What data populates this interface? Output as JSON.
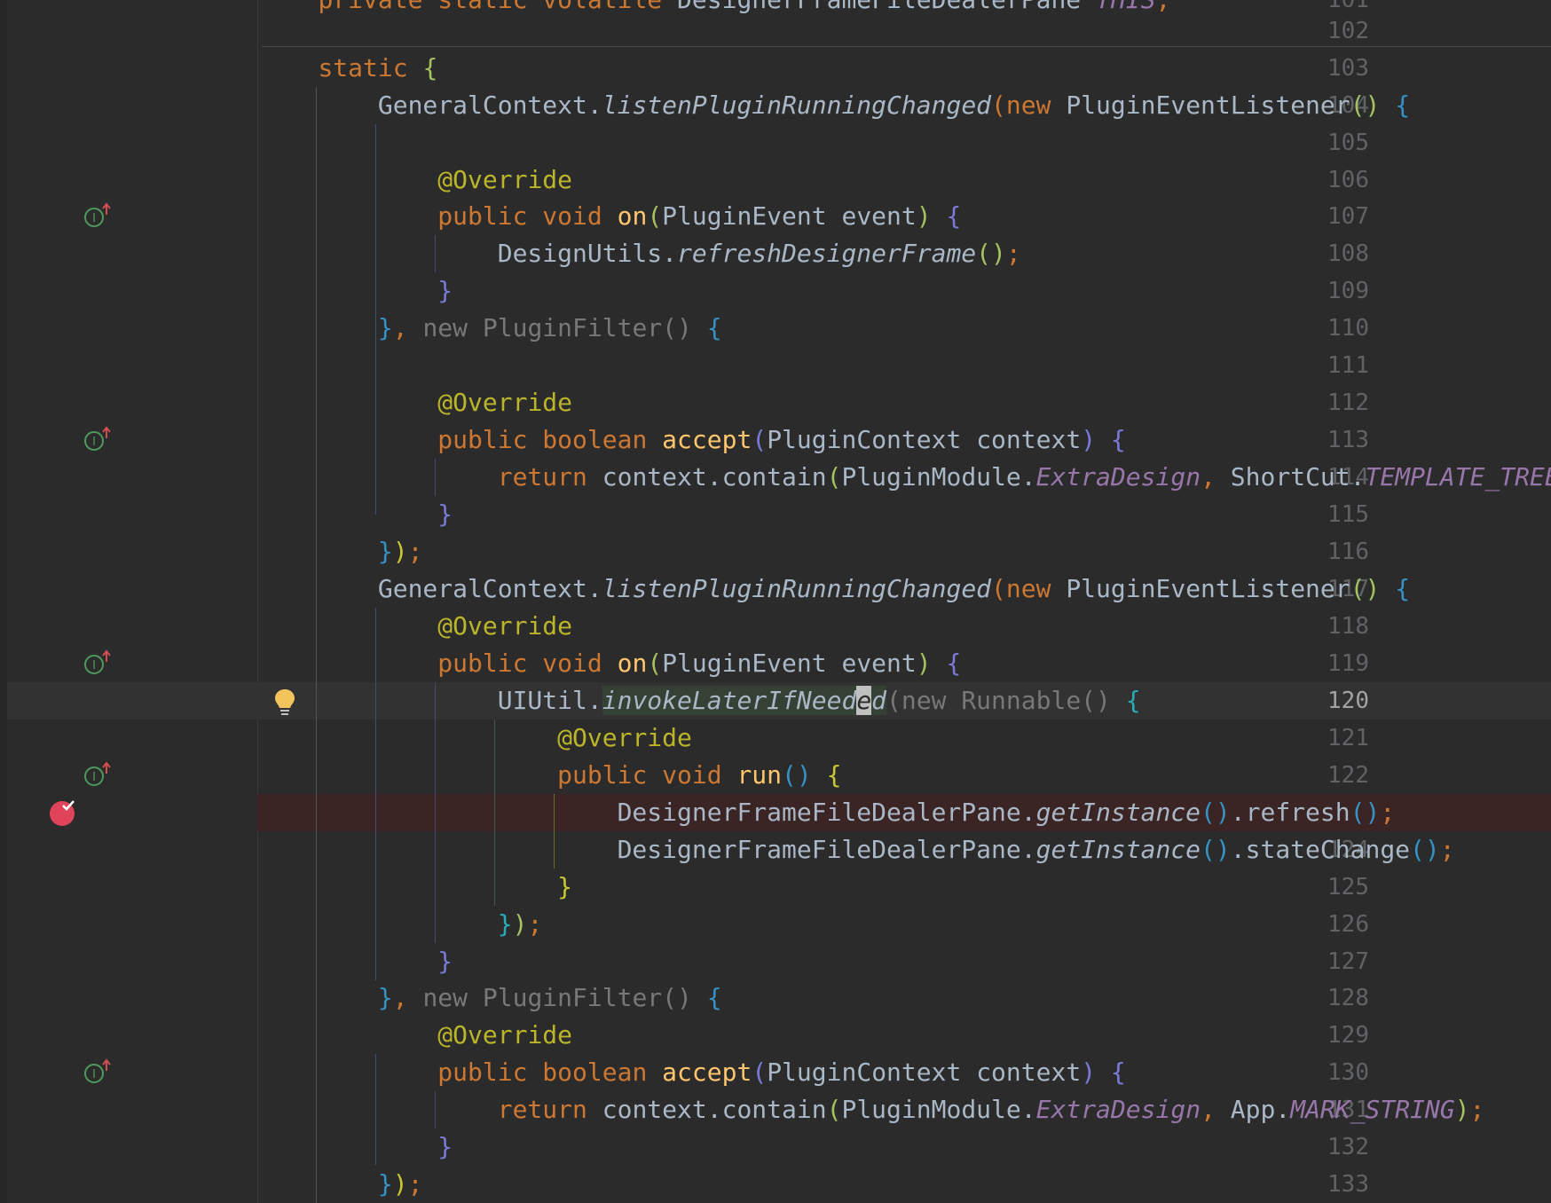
{
  "editor": {
    "language": "Java",
    "current_line": 120,
    "breakpoint_line": 123,
    "cursor": "invokeLaterIfNeeded",
    "colors": {
      "background": "#2b2b2b",
      "current_line_bg": "#323232",
      "breakpoint_line_bg": "#3a2323",
      "keyword": "#cc7832",
      "annotation": "#bbb529",
      "method_decl": "#ffc66d",
      "static_field": "#9876aa",
      "default_text": "#a9b7c6",
      "line_number": "#606366"
    }
  },
  "lines": [
    {
      "num": "101",
      "text": "    private static volatile DesignerFrameFileDealerPane THIS;"
    },
    {
      "num": "102",
      "text": ""
    },
    {
      "num": "103",
      "text": "    static {"
    },
    {
      "num": "104",
      "text": "        GeneralContext.listenPluginRunningChanged(new PluginEventListener() {"
    },
    {
      "num": "105",
      "text": ""
    },
    {
      "num": "106",
      "text": "            @Override"
    },
    {
      "num": "107",
      "text": "            public void on(PluginEvent event) {",
      "icon": "implements-method-icon"
    },
    {
      "num": "108",
      "text": "                DesignUtils.refreshDesignerFrame();"
    },
    {
      "num": "109",
      "text": "            }"
    },
    {
      "num": "110",
      "text": "        }, new PluginFilter() {"
    },
    {
      "num": "111",
      "text": ""
    },
    {
      "num": "112",
      "text": "            @Override"
    },
    {
      "num": "113",
      "text": "            public boolean accept(PluginContext context) {",
      "icon": "implements-method-icon"
    },
    {
      "num": "114",
      "text": "                return context.contain(PluginModule.ExtraDesign, ShortCut.TEMPLATE_TREE);"
    },
    {
      "num": "115",
      "text": "            }"
    },
    {
      "num": "116",
      "text": "        });"
    },
    {
      "num": "117",
      "text": "        GeneralContext.listenPluginRunningChanged(new PluginEventListener() {"
    },
    {
      "num": "118",
      "text": "            @Override"
    },
    {
      "num": "119",
      "text": "            public void on(PluginEvent event) {",
      "icon": "implements-method-icon"
    },
    {
      "num": "120",
      "text": "                UIUtil.invokeLaterIfNeeded(new Runnable() {",
      "icon": "lightbulb-icon"
    },
    {
      "num": "121",
      "text": "                    @Override"
    },
    {
      "num": "122",
      "text": "                    public void run() {",
      "icon": "implements-method-icon"
    },
    {
      "num": "123",
      "text": "                        DesignerFrameFileDealerPane.getInstance().refresh();",
      "icon": "breakpoint-icon"
    },
    {
      "num": "124",
      "text": "                        DesignerFrameFileDealerPane.getInstance().stateChange();"
    },
    {
      "num": "125",
      "text": "                    }"
    },
    {
      "num": "126",
      "text": "                });"
    },
    {
      "num": "127",
      "text": "            }"
    },
    {
      "num": "128",
      "text": "        }, new PluginFilter() {"
    },
    {
      "num": "129",
      "text": "            @Override"
    },
    {
      "num": "130",
      "text": "            public boolean accept(PluginContext context) {",
      "icon": "implements-method-icon"
    },
    {
      "num": "131",
      "text": "                return context.contain(PluginModule.ExtraDesign, App.MARK_STRING);"
    },
    {
      "num": "132",
      "text": "            }"
    },
    {
      "num": "133",
      "text": "        });"
    }
  ]
}
